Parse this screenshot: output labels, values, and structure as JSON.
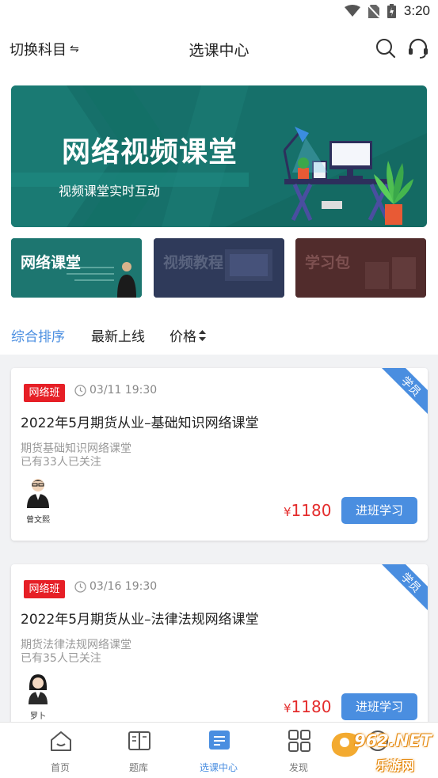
{
  "status_bar": {
    "time": "3:20",
    "icons": [
      "wifi-icon",
      "no-sim-icon",
      "battery-charging-icon"
    ]
  },
  "header": {
    "switch_subject": "切换科目",
    "switch_glyph": "⇋",
    "title": "选课中心",
    "icons": [
      "search-icon",
      "headset-icon"
    ]
  },
  "banner": {
    "title": "网络视频课堂",
    "subtitle": "视频课堂实时互动"
  },
  "categories": [
    {
      "label": "网络课堂"
    },
    {
      "label": "视频教程"
    },
    {
      "label": "学习包"
    }
  ],
  "sort": {
    "options": [
      "综合排序",
      "最新上线",
      "价格"
    ],
    "active_index": 0,
    "price_icon": "sort-arrows-icon"
  },
  "courses": [
    {
      "badge": "网络班",
      "time": "03/11 19:30",
      "title": "2022年5月期货从业–基础知识网络课堂",
      "subtitle": "期货基础知识网络课堂",
      "followers": "已有33人已关注",
      "teacher": "曾文熙",
      "currency": "¥",
      "price": "1180",
      "button": "进班学习",
      "corner": "学员"
    },
    {
      "badge": "网络班",
      "time": "03/16 19:30",
      "title": "2022年5月期货从业–法律法规网络课堂",
      "subtitle": "期货法律法规网络课堂",
      "followers": "已有35人已关注",
      "teacher": "罗卜",
      "currency": "¥",
      "price": "1180",
      "button": "进班学习",
      "corner": "学员"
    }
  ],
  "bottom_nav": {
    "items": [
      {
        "label": "首页",
        "icon": "home-icon"
      },
      {
        "label": "题库",
        "icon": "book-icon"
      },
      {
        "label": "选课中心",
        "icon": "course-list-icon"
      },
      {
        "label": "发现",
        "icon": "grid-icon"
      },
      {
        "label": "",
        "icon": "profile-icon"
      }
    ],
    "active_index": 2
  },
  "watermark": {
    "text": "962.NET",
    "subtext": "乐游网"
  },
  "colors": {
    "accent": "#4a8ee0",
    "badge_red": "#e61f26",
    "price_red": "#e42c2c",
    "banner_green": "#16706a"
  }
}
